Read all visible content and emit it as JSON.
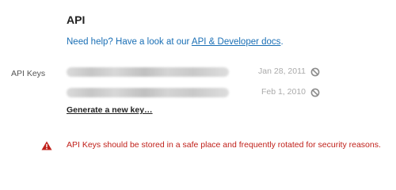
{
  "section": {
    "title": "API",
    "help_prefix": "Need help? Have a look at our ",
    "help_link": "API & Developer docs",
    "help_suffix": "."
  },
  "api_keys": {
    "label": "API Keys",
    "keys": [
      {
        "date": "Jan 28, 2011",
        "action_icon": "revoke-icon"
      },
      {
        "date": "Feb 1, 2010",
        "action_icon": "revoke-icon"
      }
    ],
    "generate_link": "Generate a new key…"
  },
  "warning": {
    "icon": "warning-icon",
    "text": "API Keys should be stored in a safe place and frequently rotated for security reasons."
  },
  "colors": {
    "link": "#1a6fb5",
    "warning": "#c0201a",
    "muted": "#aaaaaa"
  }
}
